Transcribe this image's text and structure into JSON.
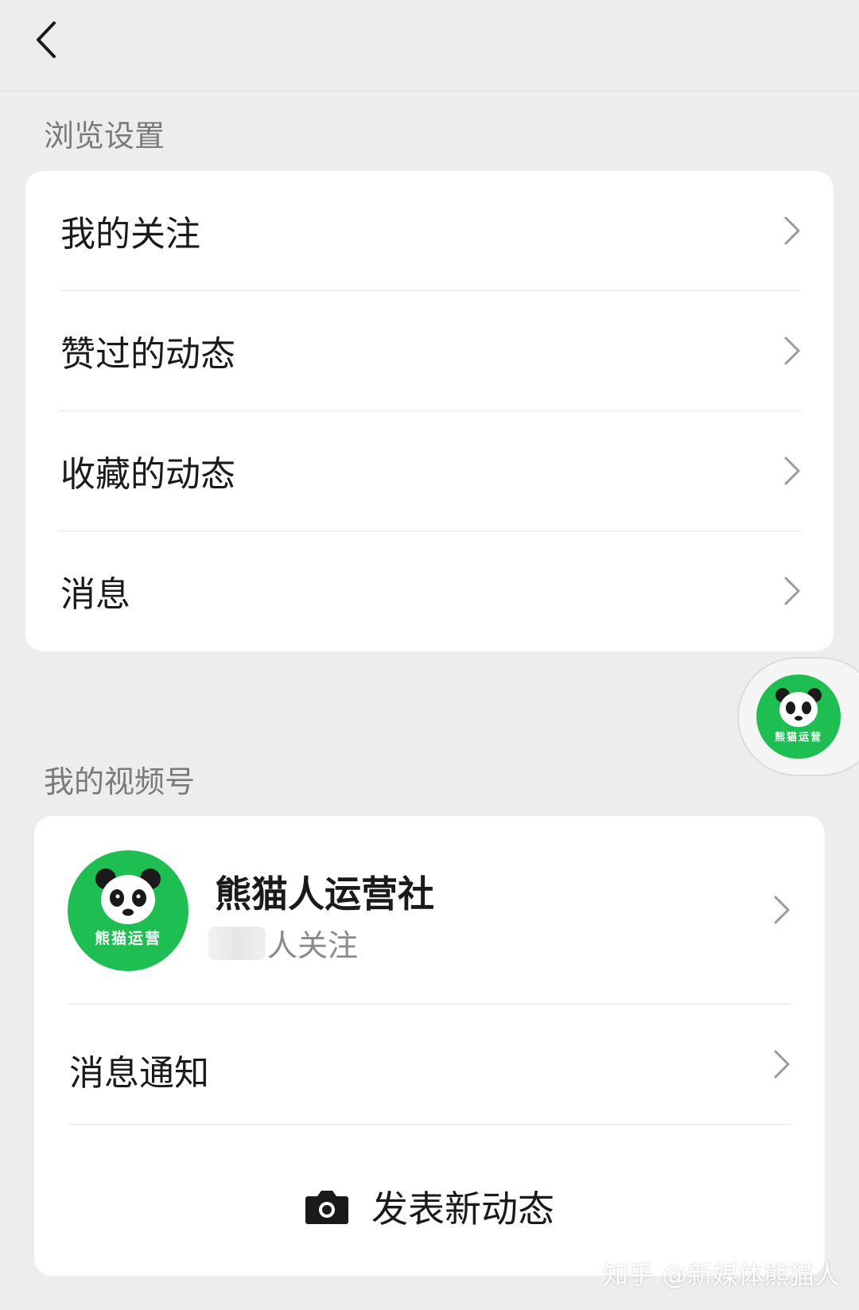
{
  "topbar": {
    "back_icon": "chevron-left-icon"
  },
  "browse_section": {
    "title": "浏览设置",
    "items": [
      {
        "label": "我的关注"
      },
      {
        "label": "赞过的动态"
      },
      {
        "label": "收藏的动态"
      },
      {
        "label": "消息"
      }
    ]
  },
  "channel_section": {
    "title": "我的视频号",
    "profile": {
      "name": "熊猫人运营社",
      "followers_suffix": "人关注",
      "avatar_text": "熊猫运营"
    },
    "items": [
      {
        "label": "消息通知"
      }
    ],
    "post_button": {
      "label": "发表新动态",
      "icon": "camera-icon"
    }
  },
  "floating_ball": {
    "avatar_text": "熊猫运营"
  },
  "watermark": "知乎 @新媒体熊猫人",
  "colors": {
    "background": "#ededed",
    "card": "#ffffff",
    "brand_green": "#1fbe52",
    "section_title": "#7a7a7a"
  }
}
